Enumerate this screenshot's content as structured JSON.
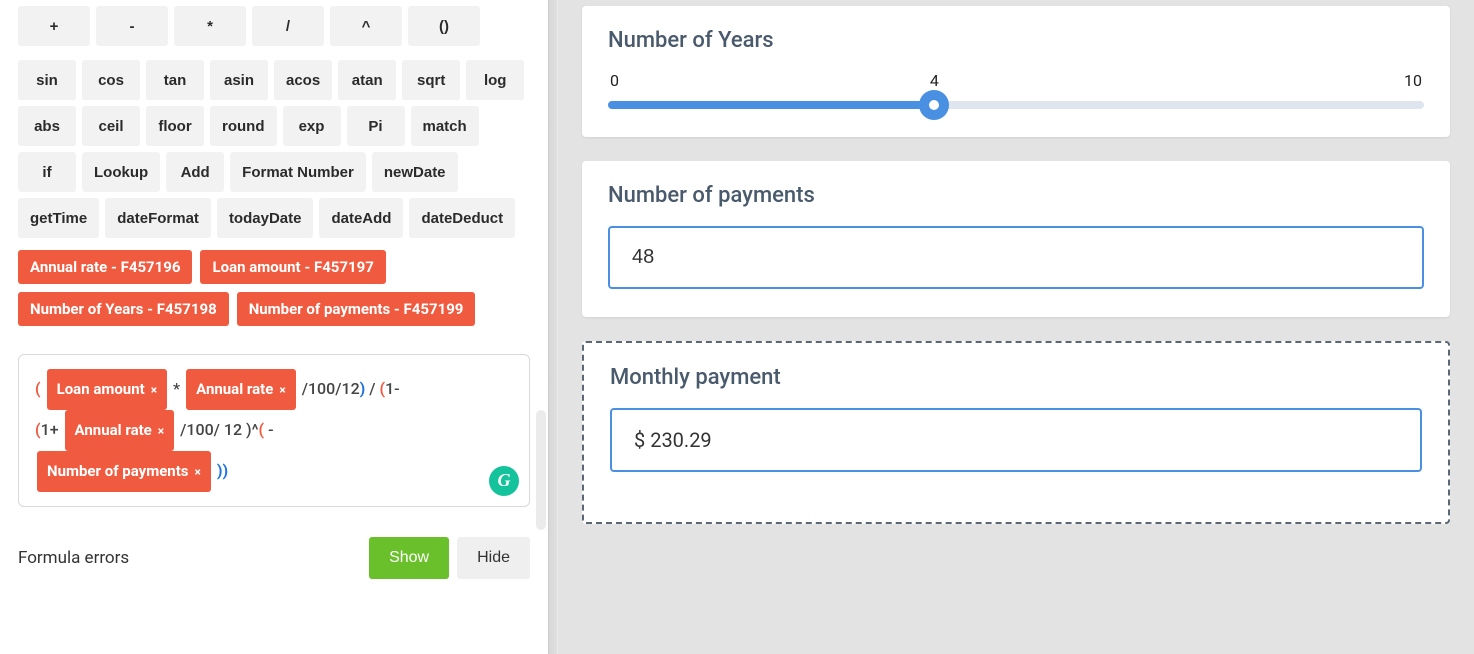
{
  "operators": {
    "row1": [
      "+",
      "-",
      "*",
      "/",
      "^",
      "()"
    ],
    "functions": [
      "sin",
      "cos",
      "tan",
      "asin",
      "acos",
      "atan",
      "sqrt",
      "log",
      "abs",
      "ceil",
      "floor",
      "round",
      "exp",
      "Pi",
      "match",
      "if",
      "Lookup",
      "Add",
      "Format Number",
      "newDate",
      "getTime",
      "dateFormat",
      "todayDate",
      "dateAdd",
      "dateDeduct"
    ]
  },
  "fields": [
    "Annual rate - F457196",
    "Loan amount - F457197",
    "Number of Years - F457198",
    "Number of payments - F457199"
  ],
  "formula": {
    "tokens": {
      "loan_amount": "Loan amount",
      "annual_rate_1": "Annual rate",
      "annual_rate_2": "Annual rate",
      "num_payments": "Number of payments"
    },
    "literals": {
      "star": " * ",
      "d100_12_close": " /100/12",
      "close_slash_open": " / ",
      "one_minus": "1-",
      "one_plus": "1+ ",
      "d100_12_caret": " /100/ 12 )^",
      "minus": " -"
    }
  },
  "errors": {
    "label": "Formula errors",
    "show": "Show",
    "hide": "Hide"
  },
  "preview": {
    "years": {
      "title": "Number of Years",
      "min": "0",
      "value": "4",
      "max": "10"
    },
    "payments": {
      "title": "Number of payments",
      "value": "48"
    },
    "monthly": {
      "title": "Monthly payment",
      "value": "$ 230.29"
    }
  }
}
